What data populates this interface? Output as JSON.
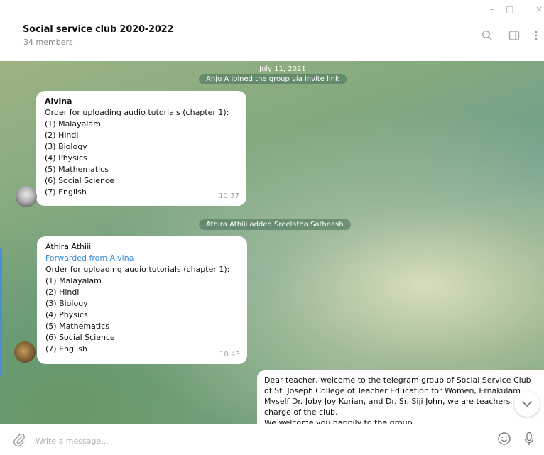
{
  "window": {
    "controls": {
      "minimize": "–",
      "maximize": "□",
      "close": "×"
    }
  },
  "header": {
    "title": "Social service club 2020-2022",
    "subtitle": "34 members",
    "icons": [
      "search-icon",
      "sidebar-toggle-icon",
      "more-vertical-icon"
    ]
  },
  "messages": {
    "date_label": "July 11, 2021",
    "service_joined": "Anju A joined the group via invite link",
    "service_added": "Athira Athiii added Sreelatha Satheesh",
    "msg1": {
      "sender": "Alvina",
      "lines": [
        "Order for uploading audio tutorials (chapter 1):",
        "(1) Malayalam",
        "(2) Hindi",
        "(3) Biology",
        "(4) Physics",
        "(5) Mathematics",
        "(6) Social Science",
        "(7) English"
      ],
      "time": "10:37"
    },
    "msg2": {
      "sender": "Athira Athiii",
      "forwarded": "Forwarded from Alvina",
      "lines": [
        "Order for uploading audio tutorials (chapter 1):",
        "(1) Malayalam",
        "(2) Hindi",
        "(3) Biology",
        "(4) Physics",
        "(5) Mathematics",
        "(6) Social Science",
        "(7) English"
      ],
      "time": "10:43"
    },
    "msg3": {
      "lines": [
        "Dear teacher, welcome to the telegram group of Social Service Club",
        "of St. Joseph College of Teacher Education for Women, Ernakulam",
        "Myself Dr. Joby Joy Kurian, and Dr. Sr. Siji John,  we are teachers",
        "charge of the club.",
        "We welcome you happily to the group."
      ]
    }
  },
  "composer": {
    "placeholder": "Write a message...",
    "icons": [
      "attach-icon",
      "emoji-icon",
      "microphone-icon"
    ]
  },
  "colors": {
    "accent": "#3b8ed6",
    "chat_bg_green": "#84a97f",
    "bubble": "#ffffff"
  }
}
